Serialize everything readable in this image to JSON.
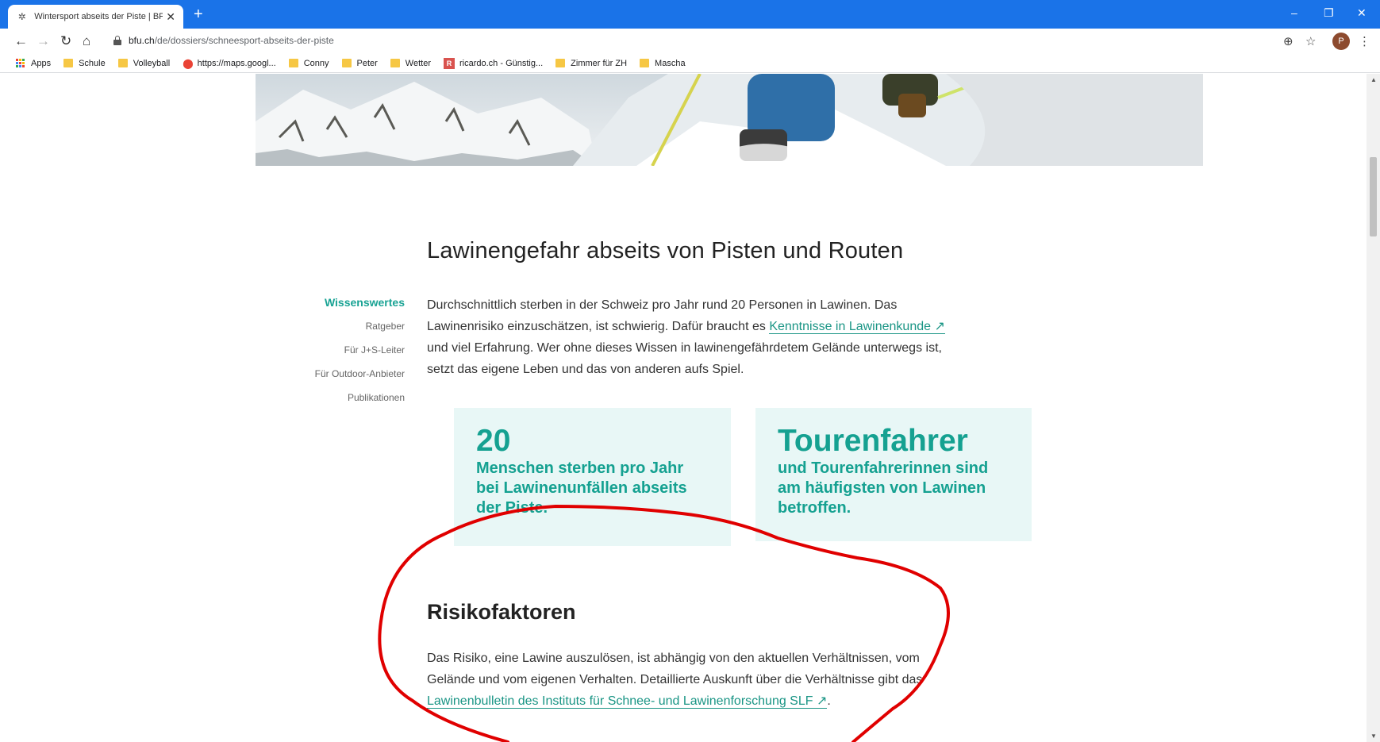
{
  "browser": {
    "tab_title": "Wintersport abseits der Piste | BF",
    "url_domain": "bfu.ch",
    "url_path": "/de/dossiers/schneesport-abseits-der-piste",
    "avatar_letter": "P"
  },
  "bookmarks": [
    {
      "label": "Apps",
      "icon": "apps-grid-icon"
    },
    {
      "label": "Schule",
      "icon": "folder-icon"
    },
    {
      "label": "Volleyball",
      "icon": "folder-icon"
    },
    {
      "label": "https://maps.googl...",
      "icon": "map-pin-icon"
    },
    {
      "label": "Conny",
      "icon": "folder-icon"
    },
    {
      "label": "Peter",
      "icon": "folder-icon"
    },
    {
      "label": "Wetter",
      "icon": "folder-icon"
    },
    {
      "label": "ricardo.ch - Günstig...",
      "icon": "ricardo-icon"
    },
    {
      "label": "Zimmer für ZH",
      "icon": "folder-icon"
    },
    {
      "label": "Mascha",
      "icon": "folder-icon"
    }
  ],
  "page": {
    "section_title": "Lawinengefahr abseits von Pisten und Routen",
    "subnav": [
      {
        "label": "Wissenswertes",
        "active": true
      },
      {
        "label": "Ratgeber",
        "active": false
      },
      {
        "label": "Für J+S-Leiter",
        "active": false
      },
      {
        "label": "Für Outdoor-Anbieter",
        "active": false
      },
      {
        "label": "Publikationen",
        "active": false
      }
    ],
    "intro": {
      "text_before": "Durchschnittlich sterben in der Schweiz pro Jahr rund 20 Personen in Lawinen. Das Lawinenrisiko einzuschätzen, ist schwierig. Dafür braucht es ",
      "link": "Kenntnisse in Lawinenkunde ↗",
      "text_after": " und viel Erfahrung. Wer ohne dieses Wissen in lawinengefährdetem Gelände unterwegs ist, setzt das eigene Leben und das von anderen aufs Spiel."
    },
    "facts": [
      {
        "big": "20",
        "text": "Menschen sterben pro Jahr bei Lawinenunfällen abseits der Piste."
      },
      {
        "big": "Tourenfahrer",
        "text": "und Tourenfahrerinnen sind am häufigsten von Lawinen betroffen."
      }
    ],
    "risk_title": "Risikofaktoren",
    "risk": {
      "text_before": "Das Risiko, eine Lawine auszulösen, ist abhängig von den aktuellen Verhältnissen, vom Gelände und vom eigenen Verhalten. Detaillierte Auskunft über die Verhältnisse gibt das ",
      "link": "Lawinenbulletin des Instituts für Schnee- und Lawinenforschung SLF ↗",
      "text_after": "."
    }
  },
  "colors": {
    "accent": "#19a394",
    "fact_bg": "#e8f7f6",
    "chrome_blue": "#1a73e8",
    "annotation": "#e00000"
  }
}
